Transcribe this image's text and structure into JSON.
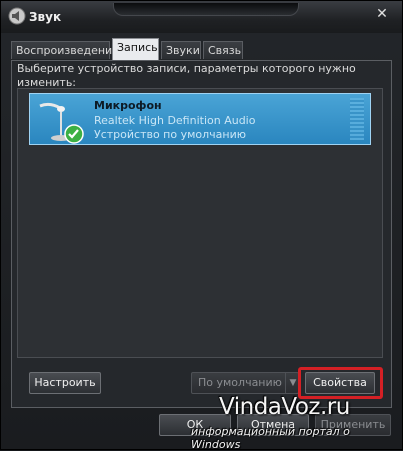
{
  "window": {
    "title": "Звук",
    "close_glyph": "✕"
  },
  "tabs": [
    {
      "label": "Воспроизведение",
      "active": false
    },
    {
      "label": "Запись",
      "active": true
    },
    {
      "label": "Звуки",
      "active": false
    },
    {
      "label": "Связь",
      "active": false
    }
  ],
  "instruction": "Выберите устройство записи, параметры которого нужно изменить:",
  "devices": [
    {
      "name": "Микрофон",
      "driver": "Realtek High Definition Audio",
      "status": "Устройство по умолчанию",
      "icon": "microphone-icon",
      "badge": "default-check-icon"
    }
  ],
  "buttons": {
    "configure": "Настроить",
    "set_default": "По умолчанию",
    "properties": "Свойства",
    "ok": "ОК",
    "cancel": "Отмена",
    "apply": "Применить"
  },
  "watermark": {
    "title": "VindaVoz.ru",
    "subtitle": "информационный портал о Windows"
  },
  "colors": {
    "highlight": "#d42025",
    "selection": "#2a86bf",
    "check": "#3cb043"
  }
}
